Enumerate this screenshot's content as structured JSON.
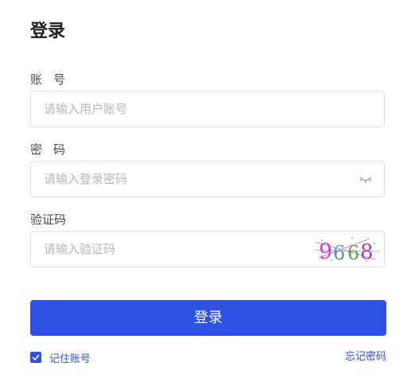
{
  "title": "登录",
  "account": {
    "label": "账号",
    "placeholder": "请输入用户账号",
    "value": ""
  },
  "password": {
    "label": "密码",
    "placeholder": "请输入登录密码",
    "value": "",
    "toggle_icon": "eye-closed-icon"
  },
  "captcha": {
    "label": "验证码",
    "placeholder": "请输入验证码",
    "value": "",
    "code": "9668"
  },
  "submit_label": "登录",
  "remember": {
    "label": "记住账号",
    "checked": true
  },
  "forgot_label": "忘记密码",
  "colors": {
    "primary": "#2c51e3",
    "border": "#dcdfe6",
    "placeholder": "#b4b7bd"
  }
}
